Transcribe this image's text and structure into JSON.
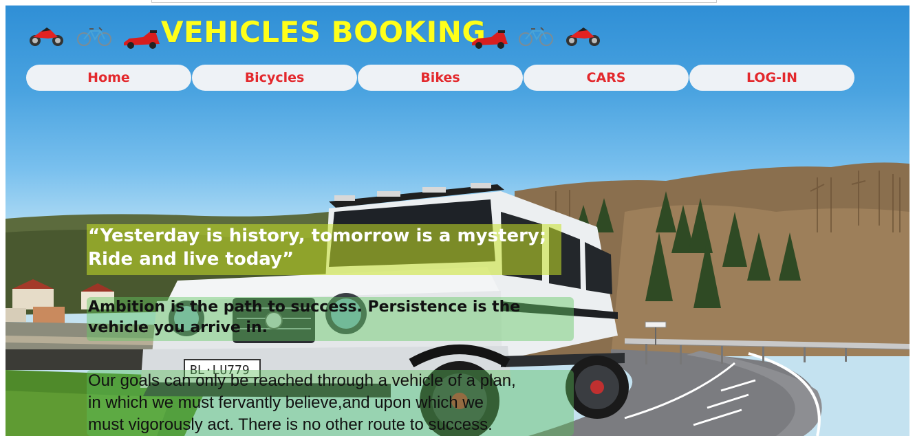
{
  "header": {
    "title": "VEHICLES BOOKING",
    "left_icons": [
      "motorcycle-icon",
      "bicycle-icon",
      "racing-car-icon"
    ],
    "right_icons": [
      "racing-car-icon",
      "bicycle-icon",
      "motorcycle-icon"
    ]
  },
  "nav": {
    "items": [
      {
        "label": "Home"
      },
      {
        "label": "Bicycles"
      },
      {
        "label": "Bikes"
      },
      {
        "label": "CARS"
      },
      {
        "label": "LOG-IN"
      }
    ]
  },
  "quotes": {
    "q1_line1": "“Yesterday is history, tomorrow is a mystery;",
    "q1_line2": "Ride and live today”",
    "q2_line1": "Ambition is the path to success. Persistence is the",
    "q2_line2": "vehicle you arrive in.",
    "q3_line1": "Our goals can only be reached through a vehicle of a plan,",
    "q3_line2": "in which we must fervantly believe,and upon which we",
    "q3_line3": "must vigorously act. There is no other route to success."
  },
  "colors": {
    "title": "#ffff1a",
    "nav_text": "#e3282c",
    "nav_bg": "#eef2f6"
  }
}
